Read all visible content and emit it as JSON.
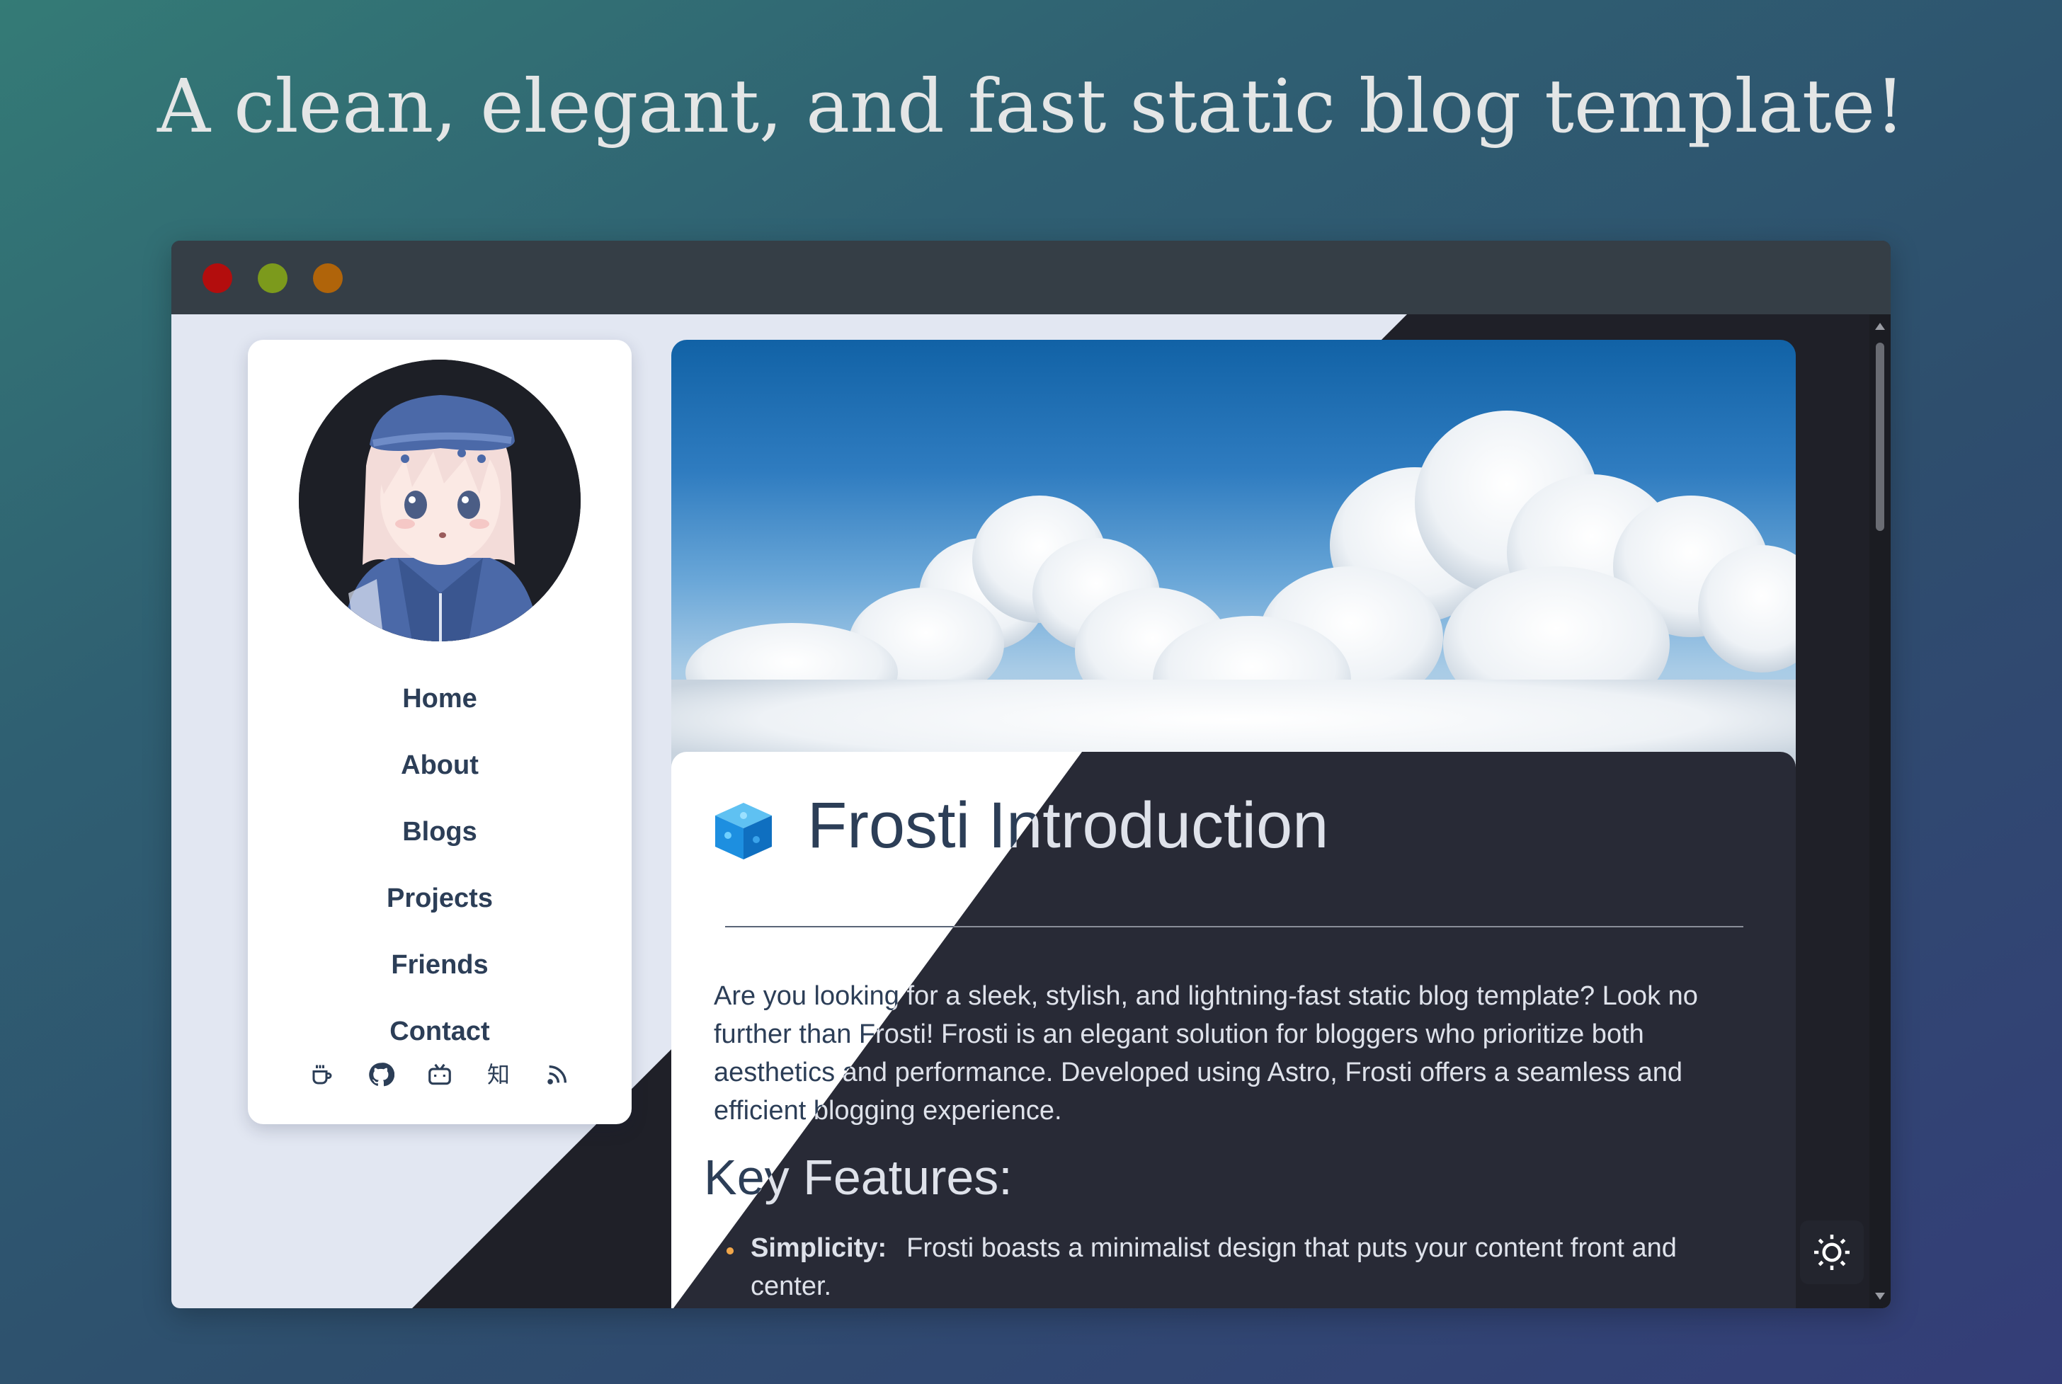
{
  "headline": "A clean, elegant, and fast static blog template!",
  "window": {
    "buttons": [
      {
        "name": "close",
        "color": "#b30d0d"
      },
      {
        "name": "minimize",
        "color": "#7c9a1c"
      },
      {
        "name": "maximize",
        "color": "#b0640a"
      }
    ]
  },
  "sidebar": {
    "nav": [
      {
        "label": "Home"
      },
      {
        "label": "About"
      },
      {
        "label": "Blogs"
      },
      {
        "label": "Projects"
      },
      {
        "label": "Friends"
      },
      {
        "label": "Contact"
      }
    ],
    "social": [
      {
        "icon": "coffee-icon",
        "glyph": "☕"
      },
      {
        "icon": "github-icon",
        "glyph": ""
      },
      {
        "icon": "bilibili-icon",
        "glyph": ""
      },
      {
        "icon": "zhihu-icon",
        "glyph": "知"
      },
      {
        "icon": "rss-icon",
        "glyph": ""
      }
    ]
  },
  "post": {
    "title": "Frosti Introduction",
    "intro": "Are you looking for a sleek, stylish, and lightning-fast static blog template? Look no further than Frosti! Frosti is an elegant solution for bloggers who prioritize both aesthetics and performance. Developed using Astro, Frosti offers a seamless and efficient blogging experience.",
    "section_heading": "Key Features:",
    "features": [
      {
        "name": "Simplicity:",
        "text": "Frosti boasts a minimalist design that puts your content front and center."
      }
    ]
  },
  "theme_toggle": {
    "icon": "sun-icon"
  },
  "colors": {
    "accent_bullet": "#f0a64a",
    "light_bg": "#e2e7f2",
    "dark_bg": "#1f2028",
    "text_dark": "#2c3e57",
    "text_light": "#dfe2ea"
  }
}
